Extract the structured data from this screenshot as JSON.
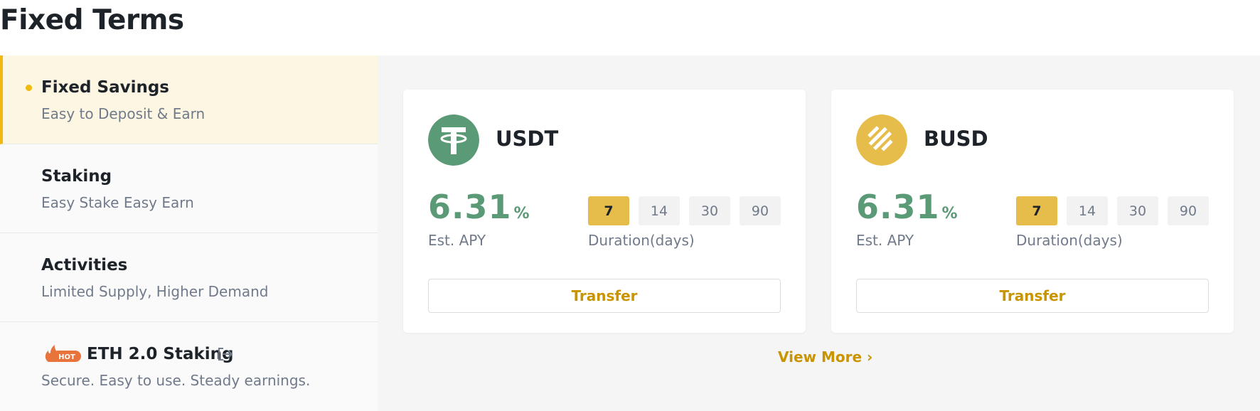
{
  "page": {
    "title": "Fixed Terms"
  },
  "sidebar": {
    "items": [
      {
        "title": "Fixed Savings",
        "subtitle": "Easy to Deposit & Earn"
      },
      {
        "title": "Staking",
        "subtitle": "Easy Stake Easy Earn"
      },
      {
        "title": "Activities",
        "subtitle": "Limited Supply, Higher Demand"
      },
      {
        "title": "ETH 2.0 Staking",
        "subtitle": "Secure. Easy to use. Steady earnings.",
        "badge": "HOT"
      }
    ]
  },
  "cards": [
    {
      "coin": "USDT",
      "icon": "usdt-icon",
      "icon_color": "#5a9a76",
      "apy": "6.31",
      "apy_unit": "%",
      "apy_label": "Est. APY",
      "durations": [
        "7",
        "14",
        "30",
        "90"
      ],
      "selected_duration": "7",
      "duration_label": "Duration(days)",
      "action": "Transfer"
    },
    {
      "coin": "BUSD",
      "icon": "busd-icon",
      "icon_color": "#e6bc4a",
      "apy": "6.31",
      "apy_unit": "%",
      "apy_label": "Est. APY",
      "durations": [
        "7",
        "14",
        "30",
        "90"
      ],
      "selected_duration": "7",
      "duration_label": "Duration(days)",
      "action": "Transfer"
    }
  ],
  "view_more": "View More ›",
  "colors": {
    "accent": "#f0b90b",
    "link": "#c99400",
    "apy_green": "#5a9a76",
    "selected_duration": "#e6bc4a"
  }
}
